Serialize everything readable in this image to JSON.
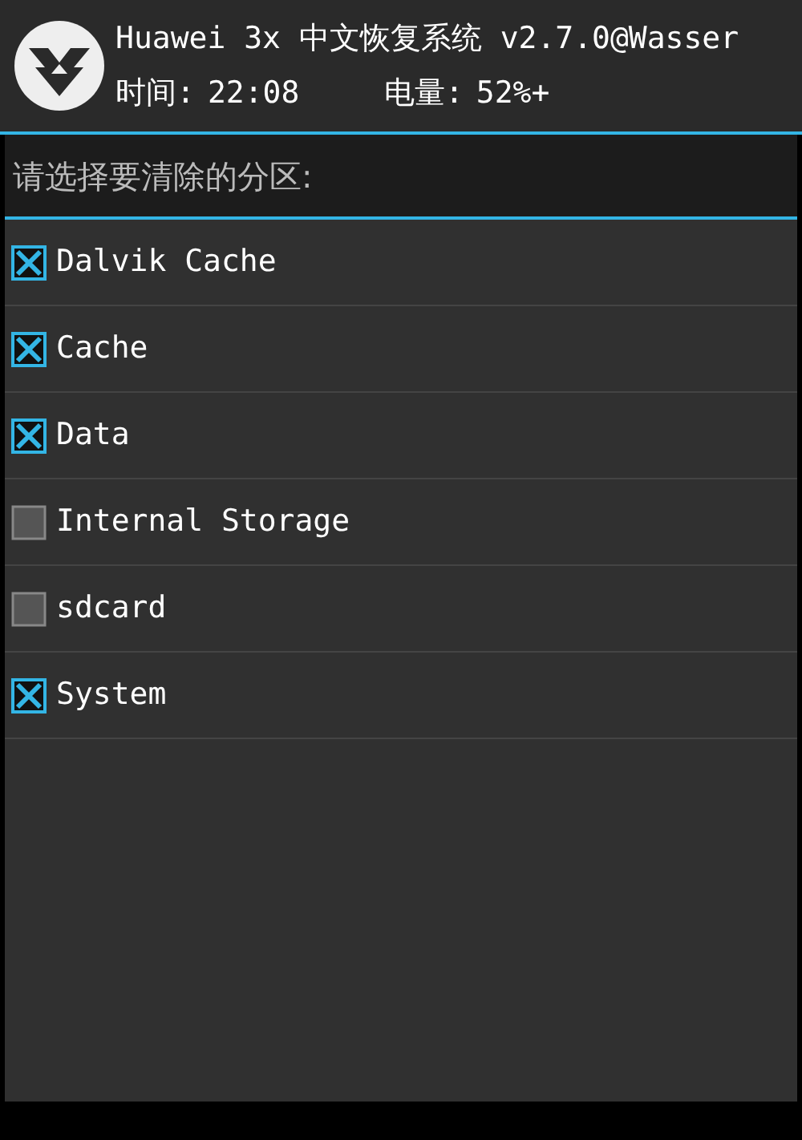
{
  "header": {
    "title": "Huawei 3x 中文恢复系统 v2.7.0@Wasser",
    "time_label": "时间:",
    "time": "22:08",
    "battery_label": "电量:",
    "battery": "52%+"
  },
  "prompt": "请选择要清除的分区:",
  "partitions": [
    {
      "label": "Dalvik Cache",
      "checked": true
    },
    {
      "label": "Cache",
      "checked": true
    },
    {
      "label": "Data",
      "checked": true
    },
    {
      "label": "Internal Storage",
      "checked": false
    },
    {
      "label": "sdcard",
      "checked": false
    },
    {
      "label": "System",
      "checked": true
    }
  ]
}
